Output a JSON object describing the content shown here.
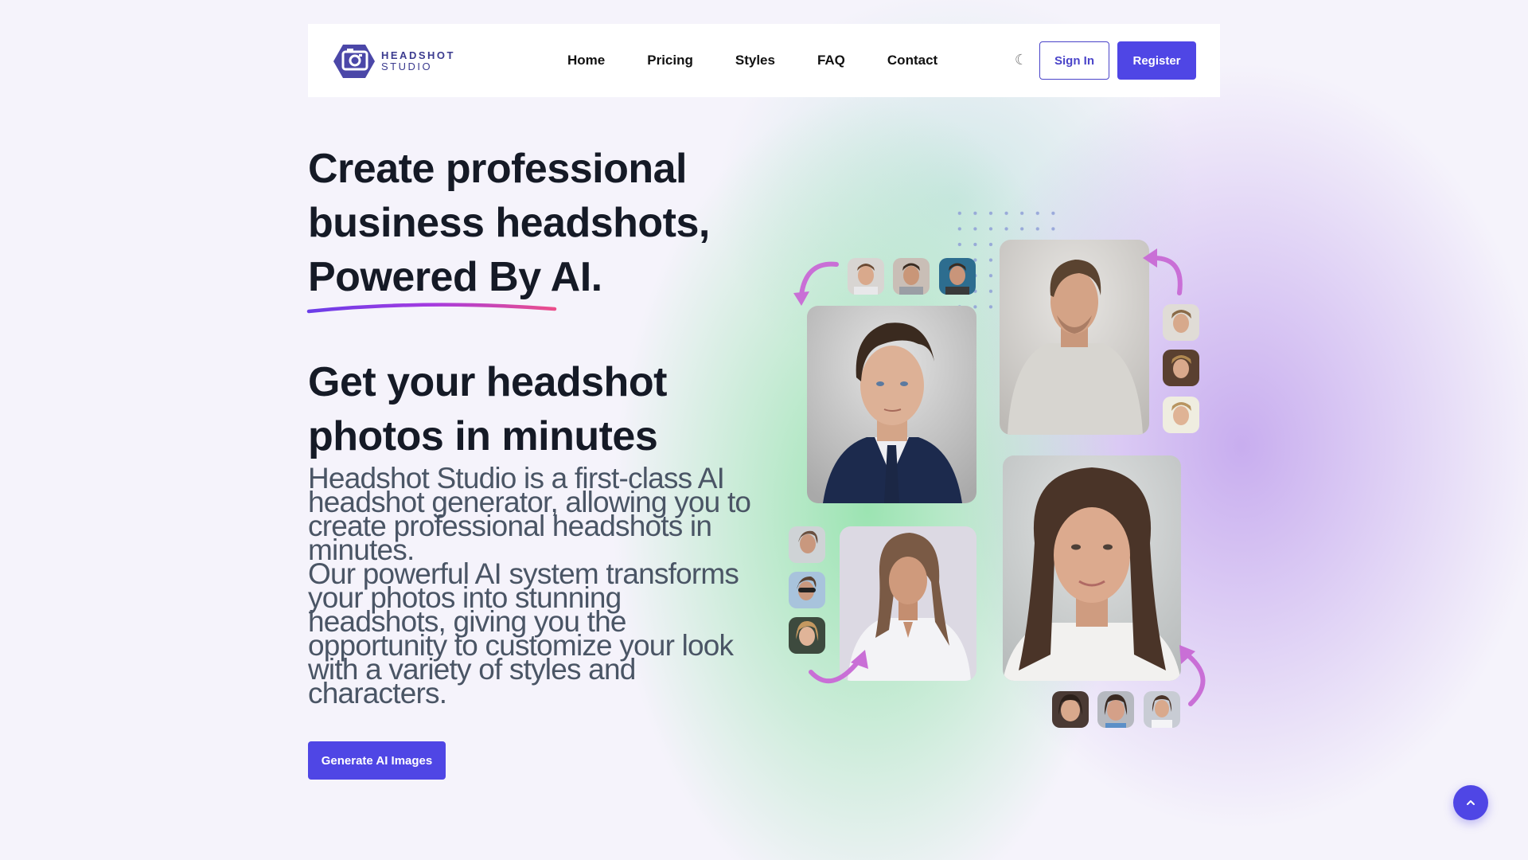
{
  "header": {
    "logo": {
      "line1": "HEADSHOT",
      "line2": "STUDIO",
      "icon": "camera-hexagon-icon"
    },
    "nav": [
      {
        "label": "Home"
      },
      {
        "label": "Pricing"
      },
      {
        "label": "Styles"
      },
      {
        "label": "FAQ"
      },
      {
        "label": "Contact"
      }
    ],
    "theme_toggle_icon": "moon-icon",
    "theme_toggle_glyph": "☾",
    "sign_in_label": "Sign In",
    "register_label": "Register"
  },
  "hero": {
    "title_line1": "Create professional",
    "title_line2": "business headshots,",
    "title_line3": "Powered By AI.",
    "subtitle_line1": "Get your headshot",
    "subtitle_line2": "photos in minutes",
    "description_p1": "Headshot Studio is a first-class AI headshot generator, allowing you to create professional headshots in minutes.",
    "description_p2": "Our powerful AI system transforms your photos into stunning headshots, giving you the opportunity to customize your look with a variety of styles and characters.",
    "cta_label": "Generate AI Images"
  },
  "colors": {
    "accent": "#4f46e5",
    "heading": "#151a26",
    "body_text": "#4a5565",
    "underline_start": "#6a3de8",
    "underline_end": "#ec4e8a",
    "arrow": "#c96fd6"
  },
  "collage": {
    "groups": [
      {
        "name": "man-suit",
        "main_alt": "Man in navy suit headshot",
        "thumb_count": 3
      },
      {
        "name": "man-tshirt",
        "main_alt": "Man in grey t-shirt headshot",
        "thumb_count": 3
      },
      {
        "name": "woman-blouse",
        "main_alt": "Woman in white blouse headshot",
        "thumb_count": 3
      },
      {
        "name": "woman-portrait",
        "main_alt": "Woman with long dark hair headshot",
        "thumb_count": 3
      }
    ]
  },
  "scroll_top": {
    "icon": "chevron-up-icon",
    "glyph": "⌃"
  }
}
